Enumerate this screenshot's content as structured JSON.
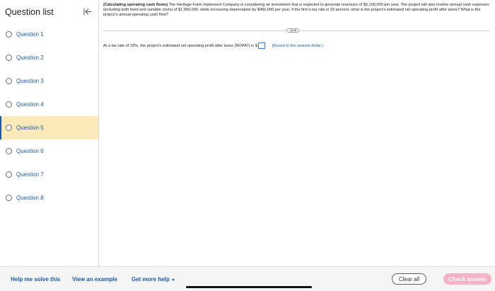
{
  "sidebar": {
    "title": "Question list",
    "collapse_icon": "collapse-left-arrow-icon",
    "questions": [
      {
        "label": "Question 1",
        "active": false
      },
      {
        "label": "Question 2",
        "active": false
      },
      {
        "label": "Question 3",
        "active": false
      },
      {
        "label": "Question 4",
        "active": false
      },
      {
        "label": "Question 5",
        "active": true
      },
      {
        "label": "Question 6",
        "active": false
      },
      {
        "label": "Question 7",
        "active": false
      },
      {
        "label": "Question 8",
        "active": false
      }
    ]
  },
  "problem": {
    "title": "(Calculating operating cash flows)",
    "text": "The Heritage Farm Implement Company is considering an investment that is expected to generate revenues of $3,100,000 per year. The project will also involve annual cash expenses (including both fixed and variable costs) of $1,050,000, while increasing depreciation by $450,000 per year. If the firm's tax rate is 33 percent, what is the project's estimated net operating profit after taxes? What is the project's annual operating cash flow?"
  },
  "answer": {
    "prompt": "At a tax rate of 33%, the project's estimated net operating profit after taxes (NOPAT) is $",
    "value": "",
    "suffix": ".",
    "hint": "(Round to the nearest dollar.)"
  },
  "footer": {
    "help_label": "Help me solve this",
    "example_label": "View an example",
    "more_help_label": "Get more help",
    "clear_label": "Clear all",
    "check_label": "Check answer"
  }
}
